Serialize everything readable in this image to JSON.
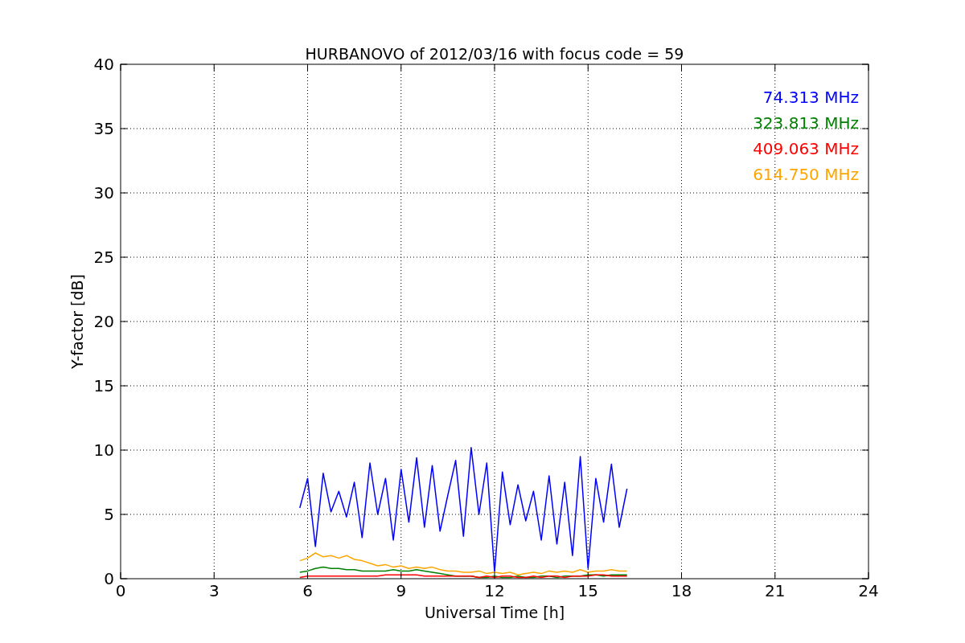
{
  "chart_data": {
    "type": "line",
    "title": "HURBANOVO of 2012/03/16 with focus code = 59",
    "xlabel": "Universal Time [h]",
    "ylabel": "Y-factor [dB]",
    "grid": true,
    "xlim": [
      0,
      24
    ],
    "ylim": [
      0,
      40
    ],
    "xticks": [
      0,
      3,
      6,
      9,
      12,
      15,
      18,
      21,
      24
    ],
    "yticks": [
      0,
      5,
      10,
      15,
      20,
      25,
      30,
      35,
      40
    ],
    "x": [
      5.75,
      6,
      6.25,
      6.5,
      6.75,
      7,
      7.25,
      7.5,
      7.75,
      8,
      8.25,
      8.5,
      8.75,
      9,
      9.25,
      9.5,
      9.75,
      10,
      10.25,
      10.5,
      10.75,
      11,
      11.25,
      11.5,
      11.75,
      12,
      12.25,
      12.5,
      12.75,
      13,
      13.25,
      13.5,
      13.75,
      14,
      14.25,
      14.5,
      14.75,
      15,
      15.25,
      15.5,
      15.75,
      16,
      16.25
    ],
    "series": [
      {
        "name": "74.313 MHz",
        "color": "#0000ff",
        "values": [
          5.5,
          7.8,
          2.5,
          8.2,
          5.2,
          6.8,
          4.8,
          7.5,
          3.2,
          9.0,
          5.0,
          7.8,
          3.0,
          8.5,
          4.4,
          9.4,
          4.0,
          8.8,
          3.7,
          6.5,
          9.2,
          3.3,
          10.2,
          5.0,
          9.0,
          0.5,
          8.3,
          4.2,
          7.3,
          4.5,
          6.8,
          3.0,
          8.0,
          2.7,
          7.5,
          1.8,
          9.5,
          0.8,
          7.8,
          4.4,
          8.9,
          4.0,
          7.0
        ]
      },
      {
        "name": "323.813 MHz",
        "color": "#008000",
        "values": [
          0.5,
          0.6,
          0.8,
          0.9,
          0.8,
          0.8,
          0.7,
          0.7,
          0.6,
          0.6,
          0.6,
          0.6,
          0.7,
          0.6,
          0.6,
          0.7,
          0.6,
          0.5,
          0.4,
          0.3,
          0.2,
          0.2,
          0.2,
          0.1,
          0.1,
          0.2,
          0.1,
          0.1,
          0.2,
          0.1,
          0.1,
          0.2,
          0.2,
          0.1,
          0.2,
          0.2,
          0.2,
          0.3,
          0.3,
          0.2,
          0.3,
          0.3,
          0.3
        ]
      },
      {
        "name": "409.063 MHz",
        "color": "#ff0000",
        "values": [
          0.1,
          0.2,
          0.2,
          0.2,
          0.2,
          0.2,
          0.2,
          0.2,
          0.2,
          0.2,
          0.2,
          0.3,
          0.3,
          0.3,
          0.3,
          0.3,
          0.2,
          0.2,
          0.2,
          0.2,
          0.2,
          0.2,
          0.2,
          0.1,
          0.2,
          0.1,
          0.2,
          0.2,
          0.1,
          0.1,
          0.2,
          0.1,
          0.2,
          0.2,
          0.1,
          0.2,
          0.2,
          0.2,
          0.3,
          0.3,
          0.2,
          0.2,
          0.2
        ]
      },
      {
        "name": "614.750 MHz",
        "color": "#ffa500",
        "values": [
          1.4,
          1.6,
          2.0,
          1.7,
          1.8,
          1.6,
          1.8,
          1.5,
          1.4,
          1.2,
          1.0,
          1.1,
          0.9,
          1.0,
          0.8,
          0.9,
          0.8,
          0.9,
          0.7,
          0.6,
          0.6,
          0.5,
          0.5,
          0.6,
          0.4,
          0.5,
          0.4,
          0.5,
          0.3,
          0.4,
          0.5,
          0.4,
          0.6,
          0.5,
          0.6,
          0.5,
          0.7,
          0.5,
          0.6,
          0.6,
          0.7,
          0.6,
          0.6
        ]
      }
    ]
  }
}
